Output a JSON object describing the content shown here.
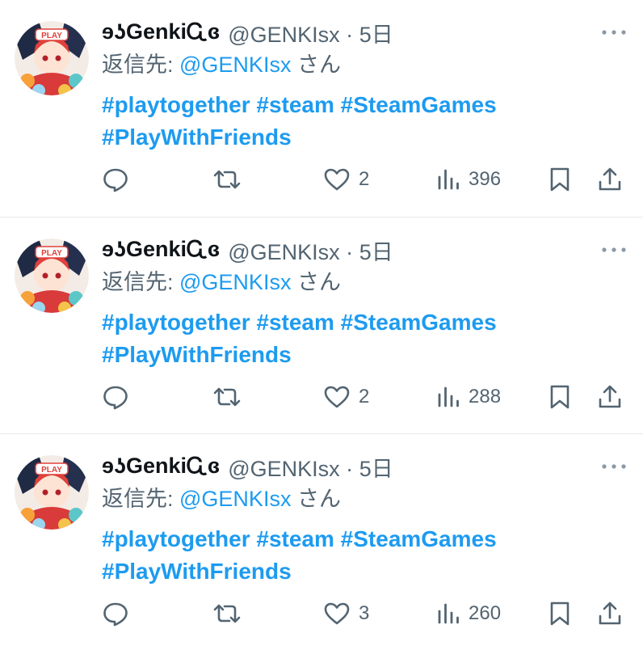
{
  "colors": {
    "link": "#1d9bf0",
    "muted": "#536471",
    "text": "#0f1419",
    "divider": "#e6e9ec"
  },
  "icons": {
    "reply": "reply-icon",
    "retweet": "retweet-icon",
    "like": "heart-icon",
    "views": "views-chart-icon",
    "bookmark": "bookmark-icon",
    "share": "share-icon",
    "more": "more-dots-icon"
  },
  "tweets": [
    {
      "name": "ɘʖGenkiᏩɞ",
      "handle": "@GENKIsx",
      "sep": "·",
      "time": "5日",
      "reply_prefix": "返信先: ",
      "reply_mention": "@GENKIsx",
      "reply_suffix": " さん",
      "line1": "#playtogether #steam #SteamGames",
      "line2": "#PlayWithFriends",
      "avatar_badge": "PLAY",
      "likes": "2",
      "views": "396"
    },
    {
      "name": "ɘʖGenkiᏩɞ",
      "handle": "@GENKIsx",
      "sep": "·",
      "time": "5日",
      "reply_prefix": "返信先: ",
      "reply_mention": "@GENKIsx",
      "reply_suffix": " さん",
      "line1": "#playtogether #steam #SteamGames",
      "line2": "#PlayWithFriends",
      "avatar_badge": "PLAY",
      "likes": "2",
      "views": "288"
    },
    {
      "name": "ɘʖGenkiᏩɞ",
      "handle": "@GENKIsx",
      "sep": "·",
      "time": "5日",
      "reply_prefix": "返信先: ",
      "reply_mention": "@GENKIsx",
      "reply_suffix": " さん",
      "line1": "#playtogether #steam #SteamGames",
      "line2": "#PlayWithFriends",
      "avatar_badge": "PLAY",
      "likes": "3",
      "views": "260"
    }
  ]
}
